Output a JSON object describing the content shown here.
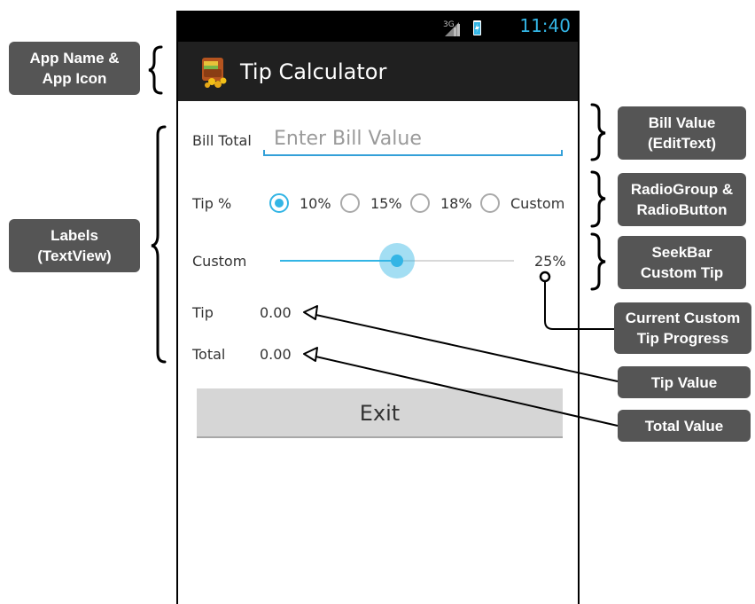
{
  "status_bar": {
    "network": "3G",
    "time": "11:40"
  },
  "action_bar": {
    "title": "Tip Calculator"
  },
  "form": {
    "bill_label": "Bill Total",
    "bill_placeholder": "Enter Bill Value",
    "tip_label": "Tip %",
    "radio_options": [
      "10%",
      "15%",
      "18%",
      "Custom"
    ],
    "selected_option": "10%",
    "custom_label": "Custom",
    "seek_progress_percent": 50,
    "custom_percent_text": "25%",
    "tip_row_label": "Tip",
    "tip_value": "0.00",
    "total_row_label": "Total",
    "total_value": "0.00",
    "exit_label": "Exit"
  },
  "callouts": {
    "app_name": [
      "App Name &",
      "App Icon"
    ],
    "labels": [
      "Labels",
      "(TextView)"
    ],
    "bill_value": [
      "Bill Value",
      "(EditText)"
    ],
    "radio_group": [
      "RadioGroup &",
      "RadioButton"
    ],
    "seekbar": [
      "SeekBar",
      "Custom Tip"
    ],
    "current_progress": [
      "Current Custom",
      "Tip  Progress"
    ],
    "tip_value": [
      "Tip Value"
    ],
    "total_value": [
      "Total Value"
    ]
  },
  "colors": {
    "accent": "#33b5e5",
    "callout_bg": "#555555",
    "action_bar": "#202020",
    "button": "#d6d6d6"
  }
}
